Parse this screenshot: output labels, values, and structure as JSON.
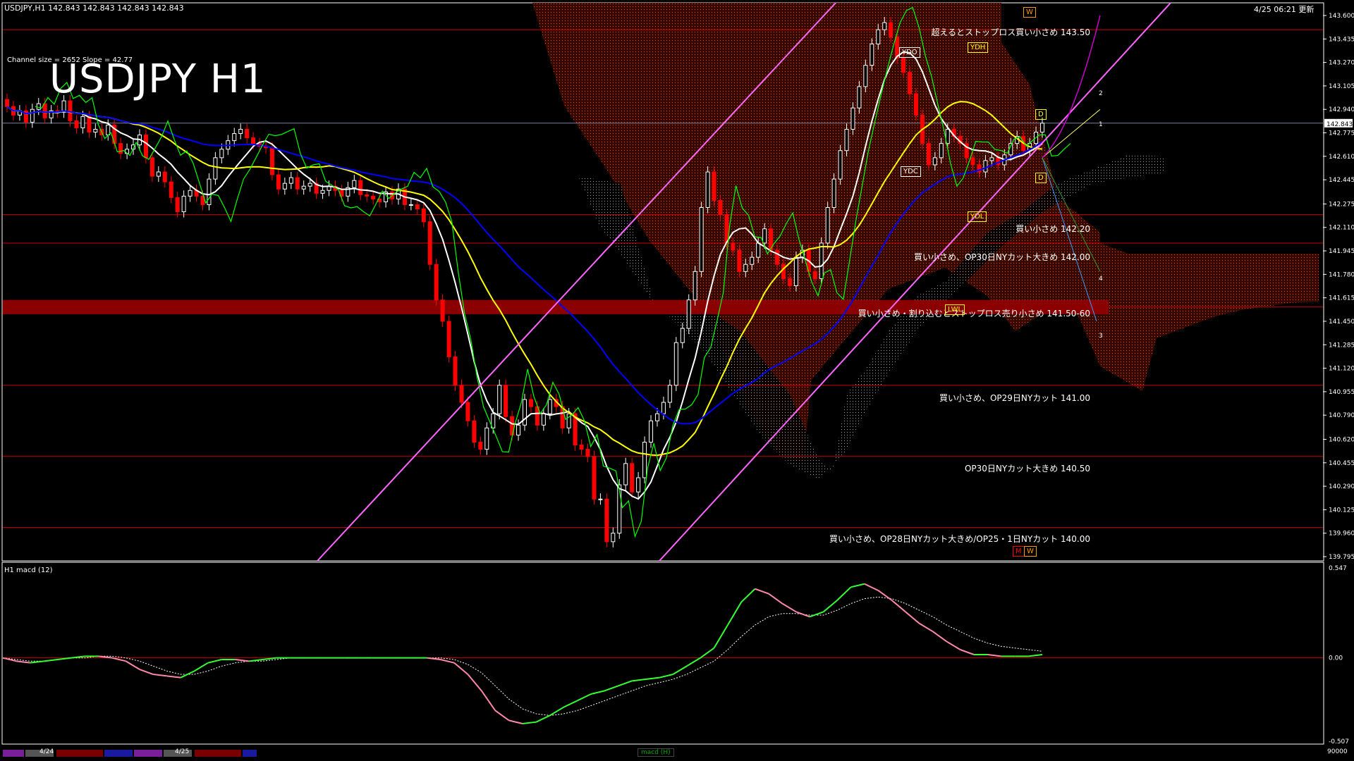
{
  "header": {
    "symbol_info": "USDJPY,H1  142.843 142.843 142.843 142.843",
    "updated": "4/25 06:21 更新"
  },
  "title": "USDJPY H1",
  "channel_info": "Channel size = 2652 Slope = 42.77",
  "macd_label": "H1  macd (12)",
  "price_labels": [
    {
      "text": "超えるとストップロス買い小さめ 143.50"
    },
    {
      "text": "買い小さめ 142.20"
    },
    {
      "text": "買い小さめ、OP30日NYカット大きめ 142.00"
    },
    {
      "text": "買い小さめ・割り込むとストップロス売り小さめ 141.50-60"
    },
    {
      "text": "買い小さめ、OP29日NYカット 141.00"
    },
    {
      "text": "OP30日NYカット大きめ 140.50"
    },
    {
      "text": "買い小さめ、OP28日NYカット大きめ/OP25・1日NYカット 140.00"
    }
  ],
  "level_tags": {
    "ydo": "YDO",
    "ydc": "YDC",
    "ydh": "YDH",
    "ydl": "YDL",
    "lwl": "LWL",
    "d": "D",
    "w": "W",
    "m": "M"
  },
  "projection_labels": [
    "1",
    "2",
    "3",
    "4"
  ],
  "footer": {
    "date1": "4/24",
    "date2": "4/25",
    "tab": "macd (H)",
    "volume": "90000"
  },
  "colors": {
    "bull": "#ffffff",
    "bear": "#ff0000",
    "ma_white": "#ffffff",
    "ma_yellow": "#ffff00",
    "ma_blue": "#0000ff",
    "chikou": "#00ff00",
    "kumo": "#ff6600",
    "channel": "#ff66ff",
    "level_line": "#cc0000",
    "grid_frame": "#ffffff"
  },
  "chart_data": [
    {
      "type": "candlestick",
      "title": "USDJPY H1",
      "ylim": [
        139.795,
        143.6
      ],
      "y_ticks": [
        143.6,
        143.435,
        143.27,
        143.105,
        142.94,
        142.775,
        142.61,
        142.445,
        142.275,
        142.11,
        141.945,
        141.78,
        141.615,
        141.45,
        141.285,
        141.12,
        140.955,
        140.79,
        140.62,
        140.455,
        140.29,
        140.125,
        139.96,
        139.795
      ],
      "y_tick_labels": [
        "143.600",
        "143.435",
        "143.270",
        "143.105",
        "142.940",
        "142.775",
        "142.610",
        "142.445",
        "142.275",
        "142.110",
        "141.945",
        "141.780",
        "141.615",
        "141.450",
        "141.285",
        "141.120",
        "140.955",
        "140.790",
        "140.620",
        "140.455",
        "140.290",
        "140.125",
        "139.960",
        "139.795"
      ],
      "current_price": 142.843,
      "current_price_label": "142.843",
      "horizontal_levels": [
        143.5,
        142.2,
        142.0,
        141.55,
        141.0,
        140.5,
        140.0
      ],
      "close": [
        142.96,
        142.9,
        142.93,
        142.85,
        142.94,
        142.98,
        142.88,
        142.93,
        142.92,
        143.0,
        142.86,
        142.81,
        142.89,
        142.78,
        142.8,
        142.76,
        142.83,
        142.7,
        142.63,
        142.66,
        142.69,
        142.76,
        142.6,
        142.47,
        142.5,
        142.43,
        142.32,
        142.22,
        142.33,
        142.37,
        142.33,
        142.27,
        142.45,
        142.6,
        142.66,
        142.72,
        142.77,
        142.8,
        142.74,
        142.7,
        142.68,
        142.67,
        142.48,
        142.38,
        142.42,
        142.46,
        142.38,
        142.4,
        142.42,
        142.35,
        142.37,
        142.4,
        142.37,
        142.33,
        142.39,
        142.44,
        142.34,
        142.33,
        142.31,
        142.29,
        142.36,
        142.31,
        142.38,
        142.27,
        142.27,
        142.24,
        142.15,
        141.85,
        141.6,
        141.45,
        141.2,
        141.0,
        140.88,
        140.75,
        140.6,
        140.55,
        140.7,
        140.8,
        141.0,
        140.78,
        140.65,
        140.72,
        140.9,
        140.85,
        140.72,
        140.8,
        140.9,
        140.85,
        140.7,
        140.8,
        140.58,
        140.55,
        140.5,
        140.2,
        140.2,
        139.9,
        139.96,
        140.3,
        140.45,
        140.25,
        140.35,
        140.6,
        140.75,
        140.8,
        140.88,
        141.0,
        141.3,
        141.4,
        141.6,
        141.8,
        142.25,
        142.5,
        142.3,
        142.2,
        142.0,
        141.95,
        141.8,
        141.85,
        141.9,
        142.0,
        142.1,
        141.95,
        141.85,
        141.75,
        141.7,
        141.9,
        141.95,
        141.8,
        141.75,
        142.0,
        142.25,
        142.45,
        142.65,
        142.8,
        142.95,
        143.1,
        143.25,
        143.4,
        143.5,
        143.55,
        143.45,
        143.3,
        143.2,
        143.05,
        142.9,
        142.7,
        142.55,
        142.6,
        142.7,
        142.8,
        142.75,
        142.7,
        142.6,
        142.55,
        142.5,
        142.58,
        142.6,
        142.55,
        142.62,
        142.7,
        142.75,
        142.65,
        142.7,
        142.78,
        142.843
      ]
    },
    {
      "type": "line",
      "title": "macd (12)",
      "ylim": [
        -0.507,
        0.547
      ],
      "y_tick_labels": [
        "0.547",
        "0.00",
        "-0.507"
      ],
      "series": [
        {
          "values": [
            0.0,
            -0.02,
            -0.03,
            -0.02,
            -0.01,
            0.0,
            0.01,
            0.01,
            0.0,
            -0.02,
            -0.07,
            -0.1,
            -0.11,
            -0.12,
            -0.08,
            -0.03,
            -0.01,
            -0.01,
            -0.02,
            -0.01,
            0.0,
            0.0,
            0.0,
            0.0,
            0.0,
            0.0,
            0.0,
            0.0,
            0.0,
            0.0,
            0.0,
            0.0,
            -0.01,
            -0.03,
            -0.1,
            -0.2,
            -0.32,
            -0.38,
            -0.4,
            -0.39,
            -0.35,
            -0.3,
            -0.26,
            -0.22,
            -0.2,
            -0.17,
            -0.14,
            -0.13,
            -0.12,
            -0.1,
            -0.05,
            0.0,
            0.06,
            0.2,
            0.34,
            0.42,
            0.39,
            0.33,
            0.28,
            0.25,
            0.28,
            0.35,
            0.43,
            0.45,
            0.41,
            0.35,
            0.28,
            0.21,
            0.16,
            0.1,
            0.05,
            0.02,
            0.02,
            0.01,
            0.01,
            0.01,
            0.02
          ]
        },
        {
          "values": [
            0.0,
            -0.01,
            -0.02,
            -0.02,
            -0.01,
            0.0,
            0.0,
            0.01,
            0.01,
            0.0,
            -0.02,
            -0.05,
            -0.08,
            -0.1,
            -0.1,
            -0.08,
            -0.05,
            -0.03,
            -0.02,
            -0.02,
            -0.01,
            0.0,
            0.0,
            0.0,
            0.0,
            0.0,
            0.0,
            0.0,
            0.0,
            0.0,
            0.0,
            0.0,
            0.0,
            -0.01,
            -0.04,
            -0.09,
            -0.17,
            -0.25,
            -0.31,
            -0.34,
            -0.35,
            -0.34,
            -0.32,
            -0.29,
            -0.26,
            -0.23,
            -0.2,
            -0.17,
            -0.15,
            -0.13,
            -0.1,
            -0.06,
            -0.02,
            0.05,
            0.13,
            0.2,
            0.25,
            0.27,
            0.27,
            0.26,
            0.26,
            0.29,
            0.33,
            0.36,
            0.37,
            0.36,
            0.33,
            0.29,
            0.25,
            0.2,
            0.16,
            0.12,
            0.09,
            0.07,
            0.06,
            0.05,
            0.04
          ]
        }
      ]
    }
  ]
}
